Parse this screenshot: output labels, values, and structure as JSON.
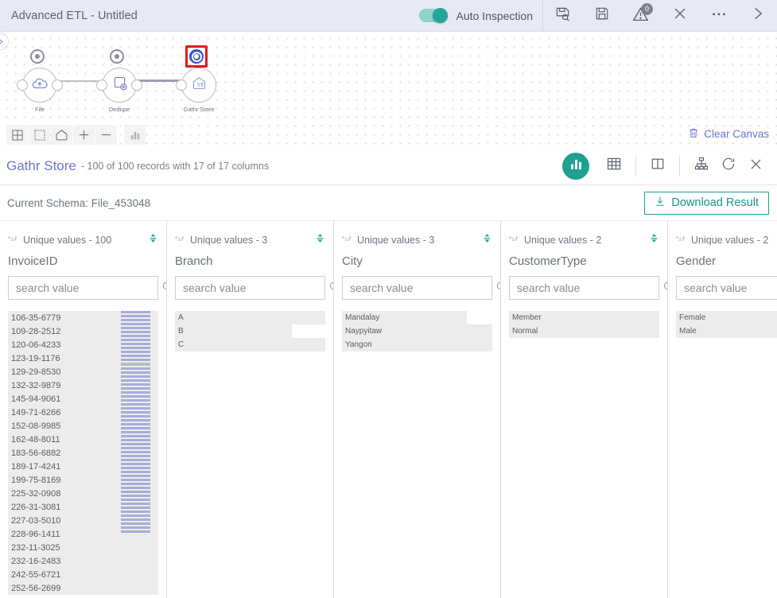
{
  "topbar": {
    "title": "Advanced ETL - Untitled",
    "toggle_label": "Auto Inspection",
    "toggle_on": true,
    "accent": "#22a699",
    "buttons": [
      {
        "name": "save-as-icon",
        "glyph": "save-as"
      },
      {
        "name": "save-icon",
        "glyph": "save"
      },
      {
        "name": "warnings-icon",
        "glyph": "warning",
        "badge": "0"
      },
      {
        "name": "close-icon",
        "glyph": "close"
      },
      {
        "name": "more-options-icon",
        "glyph": "ellipsis"
      },
      {
        "name": "expand-right-icon",
        "glyph": "chevron-right"
      }
    ]
  },
  "canvas": {
    "nodes": [
      {
        "label": "File",
        "icon": "cloud-upload-icon",
        "eye_active": false,
        "selected": false
      },
      {
        "label": "Dedupe",
        "icon": "dedupe-icon",
        "eye_active": false,
        "selected": false
      },
      {
        "label": "Gathr Store",
        "icon": "gathr-store-icon",
        "eye_active": true,
        "selected": true
      }
    ],
    "tools": [
      {
        "name": "grid-layout-tool",
        "glyph": "grid"
      },
      {
        "name": "select-area-tool",
        "glyph": "marquee"
      },
      {
        "name": "home-tool",
        "glyph": "home"
      },
      {
        "name": "zoom-in-tool",
        "glyph": "plus"
      },
      {
        "name": "zoom-out-tool",
        "glyph": "minus"
      },
      {
        "name": "inspect-chart-tool",
        "glyph": "bars"
      }
    ],
    "clear_canvas_label": "Clear Canvas"
  },
  "result": {
    "title": "Gathr Store",
    "subtitle": "- 100 of 100 records with 17 of 17 columns",
    "toolbar": [
      {
        "name": "chart-view-button",
        "glyph": "bars",
        "active": true
      },
      {
        "name": "table-view-button",
        "glyph": "table",
        "active": false
      },
      {
        "name": "columns-view-button",
        "glyph": "columns",
        "active": false
      },
      {
        "name": "schema-tree-button",
        "glyph": "tree",
        "active": false
      },
      {
        "name": "refresh-button",
        "glyph": "refresh",
        "active": false
      },
      {
        "name": "close-result-button",
        "glyph": "close",
        "active": false
      }
    ],
    "schema_label": "Current Schema: File_453048",
    "download_label": "Download Result",
    "download_color": "#1b9488"
  },
  "columns": [
    {
      "unique_label": "Unique values - 100",
      "name": "InvoiceID",
      "search_placeholder": "search value",
      "search_value": "",
      "values": [
        {
          "text": "106-35-6779",
          "pct": 100
        },
        {
          "text": "109-28-2512",
          "pct": 100
        },
        {
          "text": "120-06-4233",
          "pct": 100
        },
        {
          "text": "123-19-1176",
          "pct": 100
        },
        {
          "text": "129-29-8530",
          "pct": 100
        },
        {
          "text": "132-32-9879",
          "pct": 100
        },
        {
          "text": "145-94-9061",
          "pct": 100
        },
        {
          "text": "149-71-6266",
          "pct": 100
        },
        {
          "text": "152-08-9985",
          "pct": 100
        },
        {
          "text": "162-48-8011",
          "pct": 100
        },
        {
          "text": "183-56-6882",
          "pct": 100
        },
        {
          "text": "189-17-4241",
          "pct": 100
        },
        {
          "text": "199-75-8169",
          "pct": 100
        },
        {
          "text": "225-32-0908",
          "pct": 100
        },
        {
          "text": "226-31-3081",
          "pct": 100
        },
        {
          "text": "227-03-5010",
          "pct": 100
        },
        {
          "text": "228-96-1411",
          "pct": 100
        },
        {
          "text": "232-11-3025",
          "pct": 100
        },
        {
          "text": "232-16-2483",
          "pct": 100
        },
        {
          "text": "242-55-6721",
          "pct": 100
        },
        {
          "text": "252-56-2699",
          "pct": 100
        }
      ],
      "histogram_bars": 56,
      "histogram_cursor_index": 13
    },
    {
      "unique_label": "Unique values - 3",
      "name": "Branch",
      "search_placeholder": "search value",
      "search_value": "",
      "values": [
        {
          "text": "A",
          "pct": 100
        },
        {
          "text": "B",
          "pct": 78
        },
        {
          "text": "C",
          "pct": 100
        }
      ]
    },
    {
      "unique_label": "Unique values - 3",
      "name": "City",
      "search_placeholder": "search value",
      "search_value": "",
      "values": [
        {
          "text": "Mandalay",
          "pct": 83
        },
        {
          "text": "Naypyitaw",
          "pct": 100
        },
        {
          "text": "Yangon",
          "pct": 100
        }
      ]
    },
    {
      "unique_label": "Unique values - 2",
      "name": "CustomerType",
      "search_placeholder": "search value",
      "search_value": "",
      "values": [
        {
          "text": "Member",
          "pct": 100
        },
        {
          "text": "Normal",
          "pct": 100
        }
      ]
    },
    {
      "unique_label": "Unique values - 2",
      "name": "Gender",
      "search_placeholder": "search value",
      "search_value": "",
      "values": [
        {
          "text": "Female",
          "pct": 100
        },
        {
          "text": "Male",
          "pct": 100
        }
      ]
    }
  ]
}
